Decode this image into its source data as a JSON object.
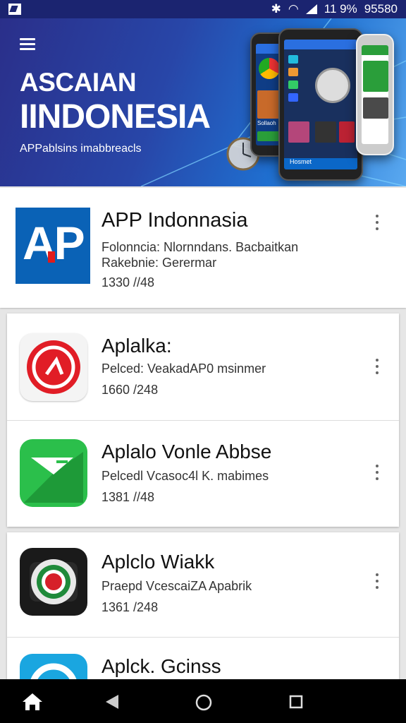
{
  "status_bar": {
    "indicators": "❄ ◠",
    "battery_text": "11 9%",
    "time": "95580"
  },
  "banner": {
    "title_line1": "ASCAIAN",
    "title_line2": "IINDONESIA",
    "subtitle": "APPablsins imabbreacls",
    "phone_left_label": "Sollaoh",
    "phone_center_label": "Hosmet"
  },
  "featured": {
    "title": "APP Indonnasia",
    "line1": "Folonncia: Nlornndans. Bacbaitkan",
    "line2": "Rakebnie: Gerermar",
    "line3": "1330 //48",
    "icon_text": "AP",
    "icon": "ap-logo-icon"
  },
  "apps": [
    {
      "title": "Aplalka:",
      "line1": "Pelced: VeakadAP0 msinmer",
      "line2": "1660 /248",
      "icon": "red-circle-icon"
    },
    {
      "title": "Aplalo Vonle Abbse",
      "line1": "Pelcedl Vcasoc4l K. mabimes",
      "line2": "1381 //48",
      "icon": "green-flag-icon"
    },
    {
      "title": "Aplclo Wiakk",
      "line1": "Praepd VcescaiZA Apabrik",
      "line2": "1361 /248",
      "icon": "camera-lens-icon"
    },
    {
      "title": "Aplck. Gcinss",
      "icon": "blue-ring-icon"
    }
  ],
  "colors": {
    "banner_start": "#2a2f8a",
    "banner_end": "#5aa9f0",
    "ap_blue": "#0a62b6",
    "ap_red": "#e21b1b",
    "red_icon": "#e11d26",
    "green_icon": "#2bbf4b"
  },
  "nav": {
    "home": "home-icon",
    "back": "back-icon",
    "recents": "recents-icon",
    "circle": "circle-home-icon"
  }
}
